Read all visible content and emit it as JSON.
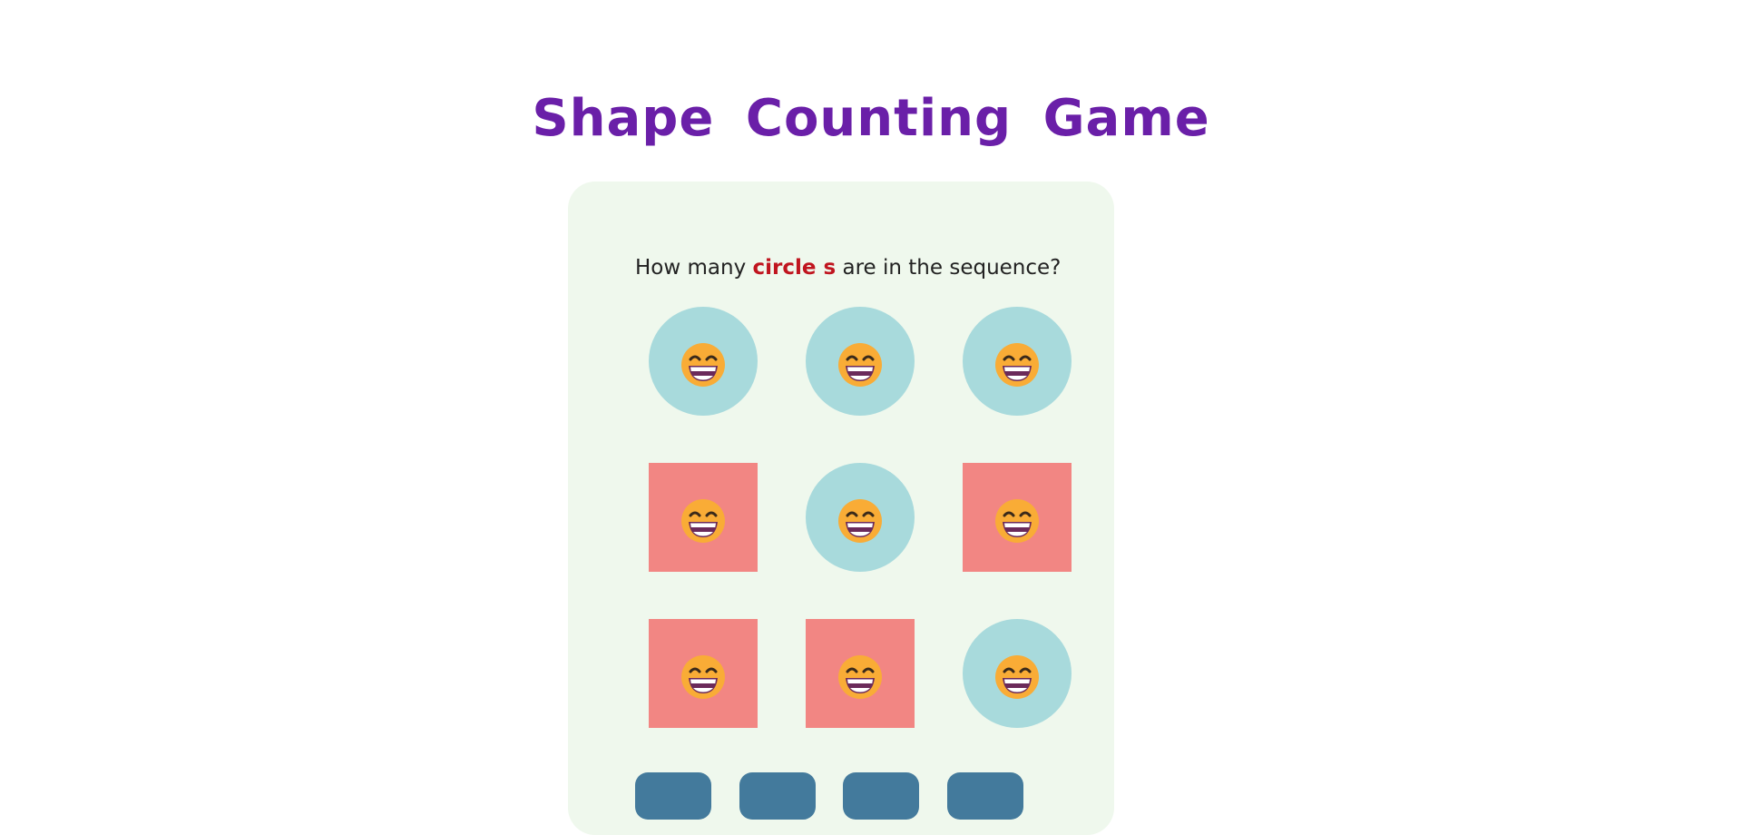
{
  "game": {
    "title": "Shape Counting Game",
    "question": {
      "prefix": "How many",
      "target": "circle s",
      "suffix": "are in the sequence?"
    },
    "grid": [
      {
        "shape": "circle",
        "icon": "grinning-face-icon"
      },
      {
        "shape": "circle",
        "icon": "grinning-face-icon"
      },
      {
        "shape": "circle",
        "icon": "grinning-face-icon"
      },
      {
        "shape": "square",
        "icon": "grinning-face-icon"
      },
      {
        "shape": "circle",
        "icon": "grinning-face-icon"
      },
      {
        "shape": "square",
        "icon": "grinning-face-icon"
      },
      {
        "shape": "square",
        "icon": "grinning-face-icon"
      },
      {
        "shape": "square",
        "icon": "grinning-face-icon"
      },
      {
        "shape": "circle",
        "icon": "grinning-face-icon"
      }
    ],
    "answer_options": [
      {
        "label": ""
      },
      {
        "label": ""
      },
      {
        "label": ""
      },
      {
        "label": ""
      }
    ]
  },
  "colors": {
    "title": "#6a1fa8",
    "card_background": "#eff8ed",
    "highlight": "#c0151f",
    "circle": "#a8dadc",
    "square": "#f28683",
    "option_button": "#437a9c",
    "face": "#f9ac36"
  }
}
